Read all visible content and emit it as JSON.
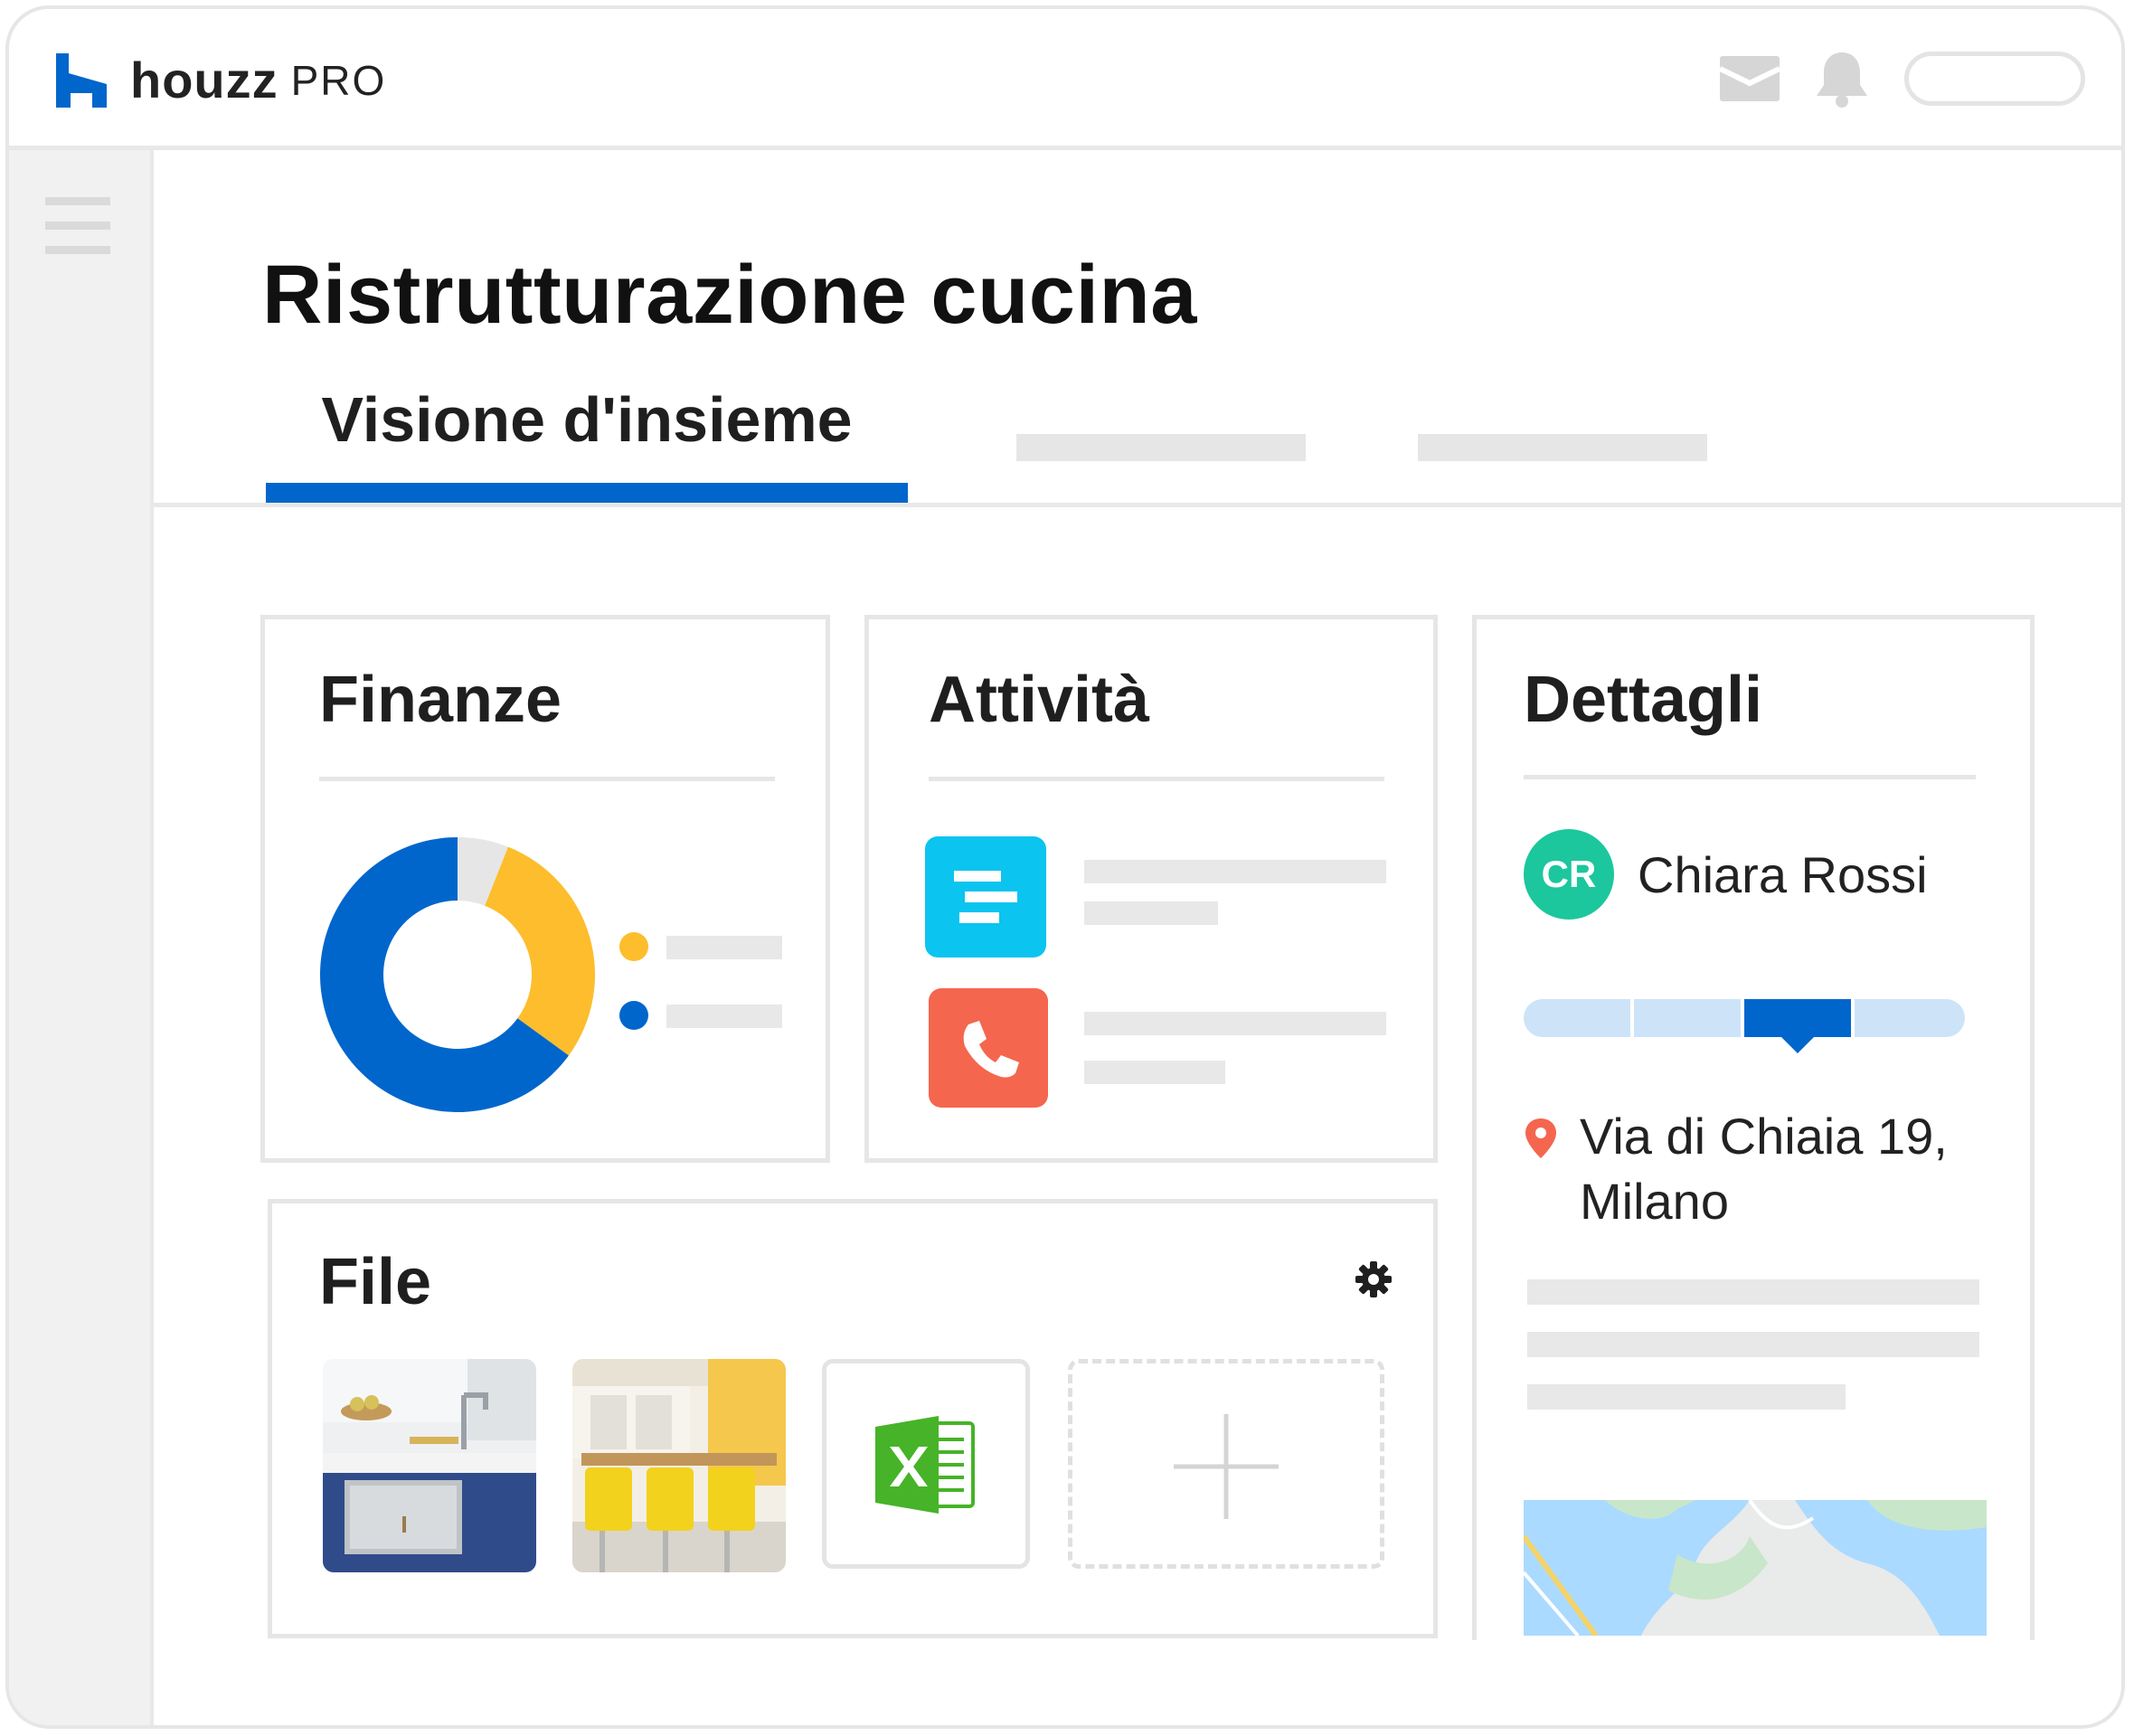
{
  "app": {
    "brand": "houzz",
    "brand_suffix": "PRO"
  },
  "page": {
    "title": "Ristrutturazione cucina"
  },
  "tabs": [
    {
      "label": "Visione d'insieme",
      "active": true
    }
  ],
  "cards": {
    "finance": {
      "title": "Finanze"
    },
    "activity": {
      "title": "Attività"
    },
    "details": {
      "title": "Dettagli",
      "client_initials": "CR",
      "client_name": "Chiara Rossi",
      "address_line1": "Via di Chiaia 19,",
      "address_line2": "Milano",
      "stage_progress": {
        "current_stage": 3,
        "total_stages": 4
      }
    },
    "files": {
      "title": "File"
    }
  },
  "colors": {
    "accent": "#0066cc",
    "donut_blue": "#0066cc",
    "donut_yellow": "#fdbd2c",
    "donut_grey": "#e6e6e6",
    "task_icon": "#0bc4ef",
    "call_icon": "#f5664e",
    "avatar": "#1cc79d"
  },
  "icons": {
    "logo": "houzz-logo-icon",
    "inbox": "inbox-icon",
    "bell": "bell-icon",
    "menu": "hamburger-menu-icon",
    "task": "timeline-icon",
    "call": "phone-icon",
    "location": "location-pin-icon",
    "settings": "gear-icon",
    "excel": "excel-file-icon",
    "add": "plus-icon"
  },
  "chart_data": {
    "type": "pie",
    "values": [
      6,
      29,
      65
    ],
    "colors": [
      "#e6e6e6",
      "#fdbd2c",
      "#0066cc"
    ]
  }
}
